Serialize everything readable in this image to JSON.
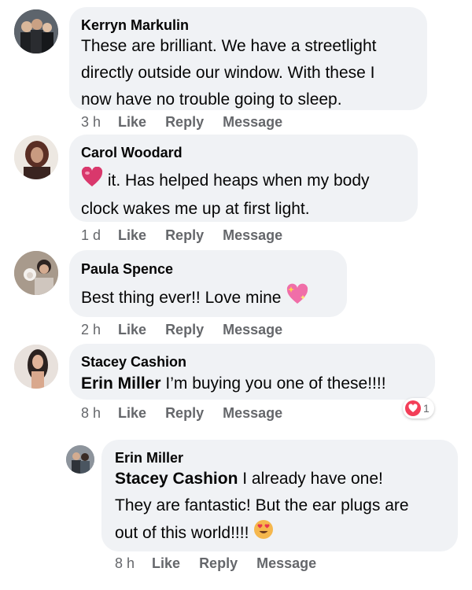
{
  "comments": [
    {
      "author": "Kerryn Markulin",
      "text": [
        "These are brilliant. We have a streetlight",
        "directly outside our window. With these I",
        "now have no trouble going to sleep."
      ],
      "time": "3 h",
      "like": "Like",
      "reply": "Reply",
      "message": "Message"
    },
    {
      "author": "Carol Woodard",
      "text_after_emoji": "it. Has helped heaps when my body",
      "text_line2": "clock wakes me up at first light.",
      "emoji": "heart-emoji",
      "time": "1 d",
      "like": "Like",
      "reply": "Reply",
      "message": "Message"
    },
    {
      "author": "Paula Spence",
      "text": "Best thing ever!! Love mine",
      "emoji": "sparkling-heart-emoji",
      "time": "2 h",
      "like": "Like",
      "reply": "Reply",
      "message": "Message"
    },
    {
      "author": "Stacey Cashion",
      "mention": "Erin Miller",
      "text": "I’m buying you one of these!!!!",
      "time": "8 h",
      "like": "Like",
      "reply": "Reply",
      "message": "Message",
      "reaction": {
        "type": "love",
        "count": "1",
        "color": "#f33e58"
      }
    }
  ],
  "reply": {
    "author": "Erin Miller",
    "mention": "Stacey Cashion",
    "text_line1": "I already have one!",
    "text_line2": "They are fantastic! But the ear plugs are",
    "text_line3": "out of this world!!!!",
    "emoji": "heart-eyes-emoji",
    "time": "8 h",
    "like": "Like",
    "reply": "Reply",
    "message": "Message"
  },
  "colors": {
    "bubble": "#f0f2f5",
    "secondary_text": "#65676b",
    "text": "#050505"
  }
}
